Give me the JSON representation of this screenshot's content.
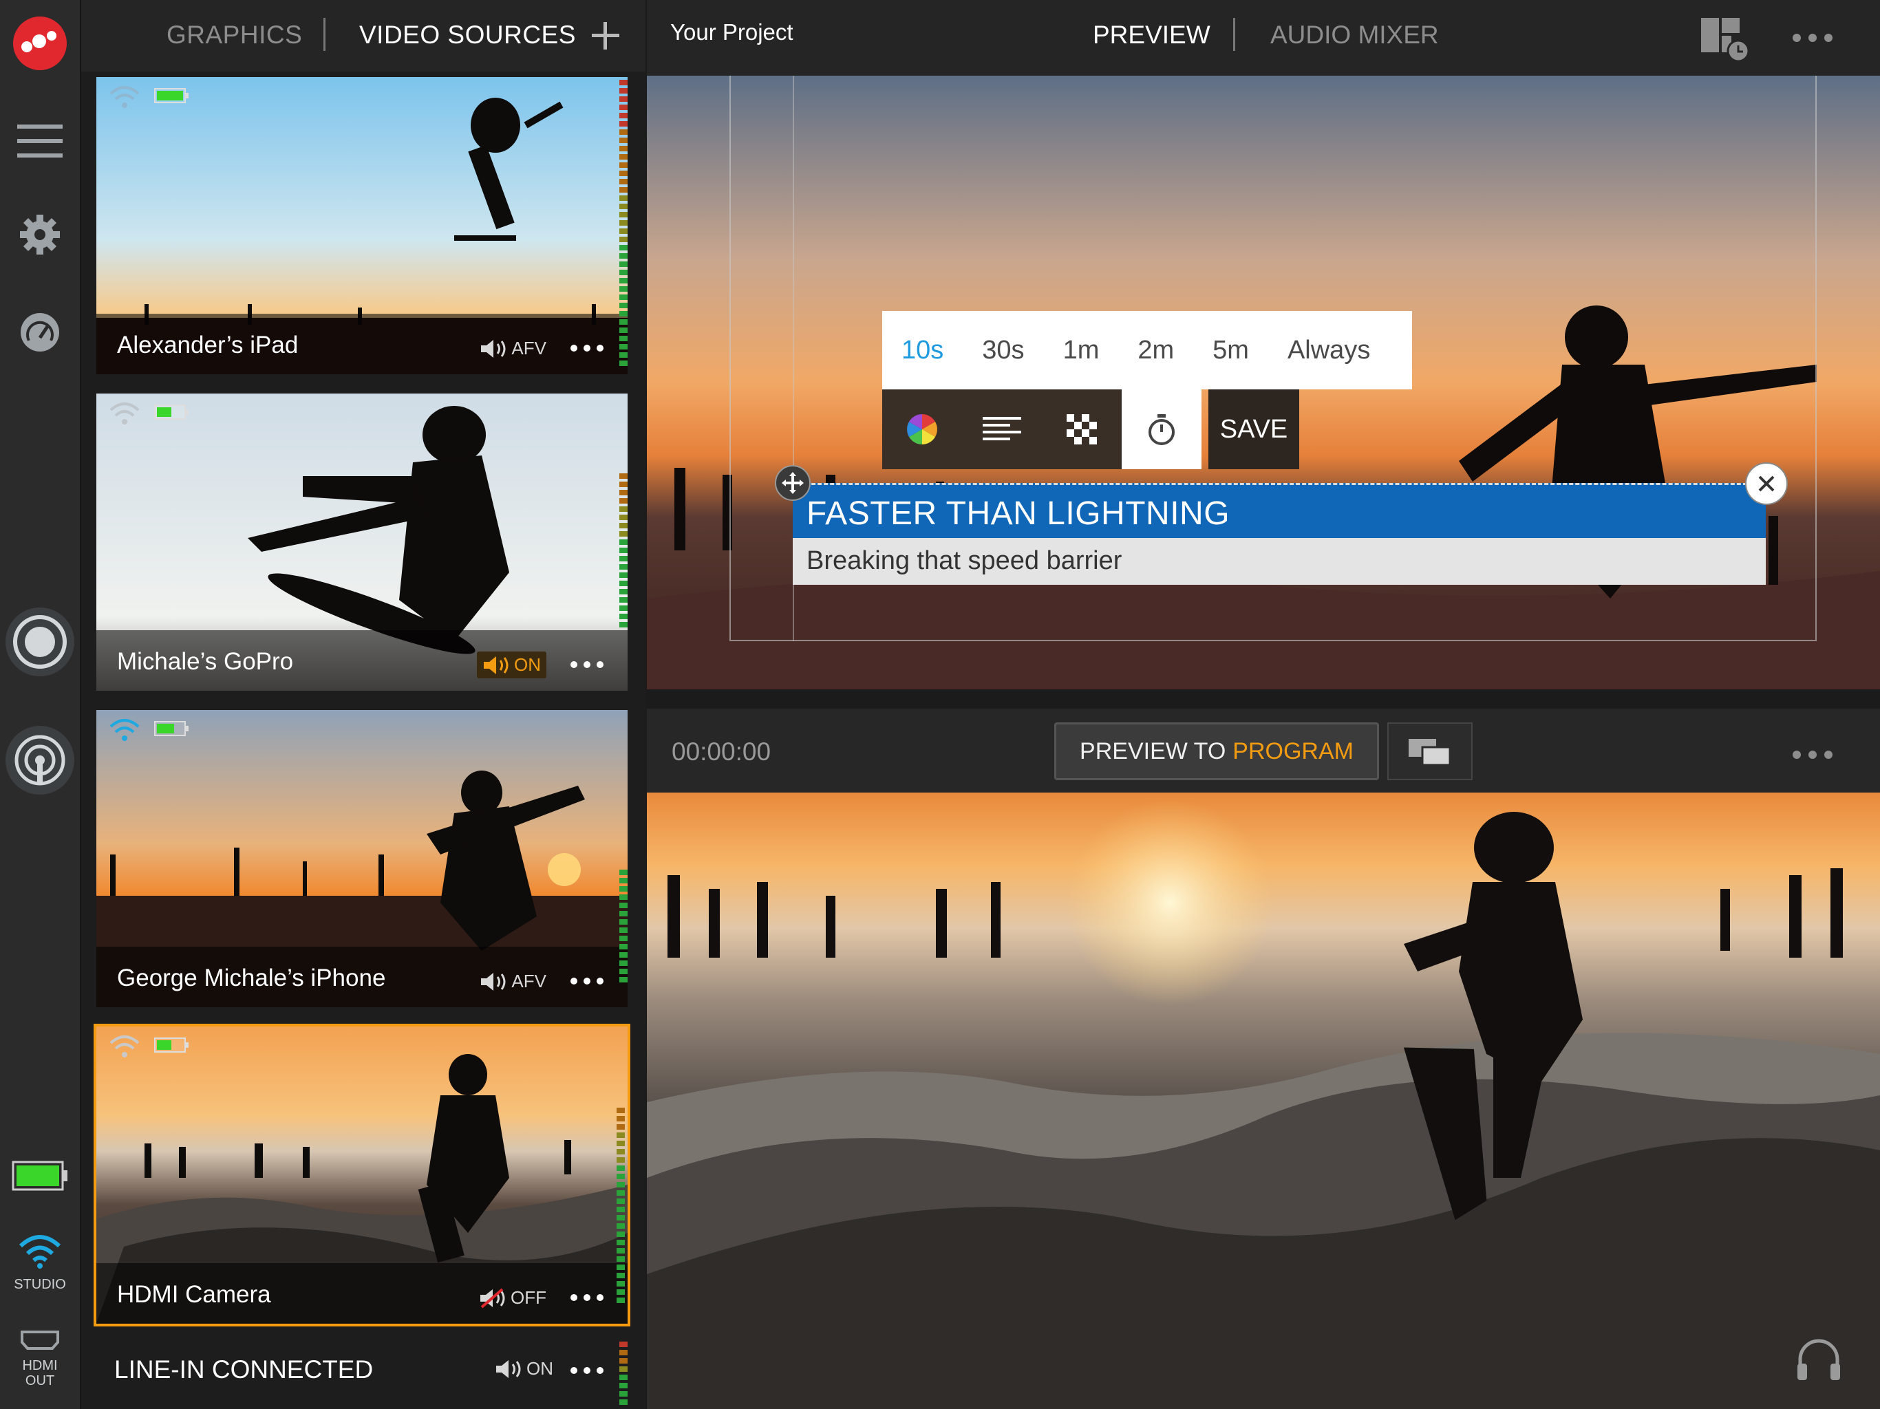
{
  "app": {
    "project_title": "Your Project",
    "tabs_left": {
      "graphics": "GRAPHICS",
      "video_sources": "VIDEO SOURCES"
    },
    "tabs_right": {
      "preview": "PREVIEW",
      "audio_mixer": "AUDIO MIXER"
    }
  },
  "rail": {
    "studio_label": "STUDIO",
    "hdmi_label_1": "HDMI",
    "hdmi_label_2": "OUT"
  },
  "sources": [
    {
      "name": "Alexander’s iPad",
      "audio": "AFV",
      "audio_state": "afv",
      "battery": 1.0,
      "selected": false
    },
    {
      "name": "Michale’s GoPro",
      "audio": "ON",
      "audio_state": "on",
      "battery": 0.55,
      "selected": false
    },
    {
      "name": "George Michale’s iPhone",
      "audio": "AFV",
      "audio_state": "afv",
      "battery": 0.65,
      "selected": false
    },
    {
      "name": "HDMI Camera",
      "audio": "OFF",
      "audio_state": "off",
      "battery": 0.55,
      "selected": true
    }
  ],
  "line_in": {
    "name": "LINE-IN CONNECTED",
    "audio": "ON"
  },
  "preview": {
    "duration_options": [
      "10s",
      "30s",
      "1m",
      "2m",
      "5m",
      "Always"
    ],
    "duration_selected": "10s",
    "save_label": "SAVE",
    "lower_third_title": "FASTER THAN LIGHTNING",
    "lower_third_subtitle": "Breaking that speed barrier"
  },
  "program": {
    "timecode": "00:00:00",
    "p2p_a": "PREVIEW TO",
    "p2p_b": "PROGRAM"
  },
  "colors": {
    "accent_orange": "#f39c12",
    "accent_blue": "#1e9be0",
    "lower_third_blue": "#1167b7",
    "battery_green": "#3bd62a",
    "logo_red": "#e0282e"
  }
}
